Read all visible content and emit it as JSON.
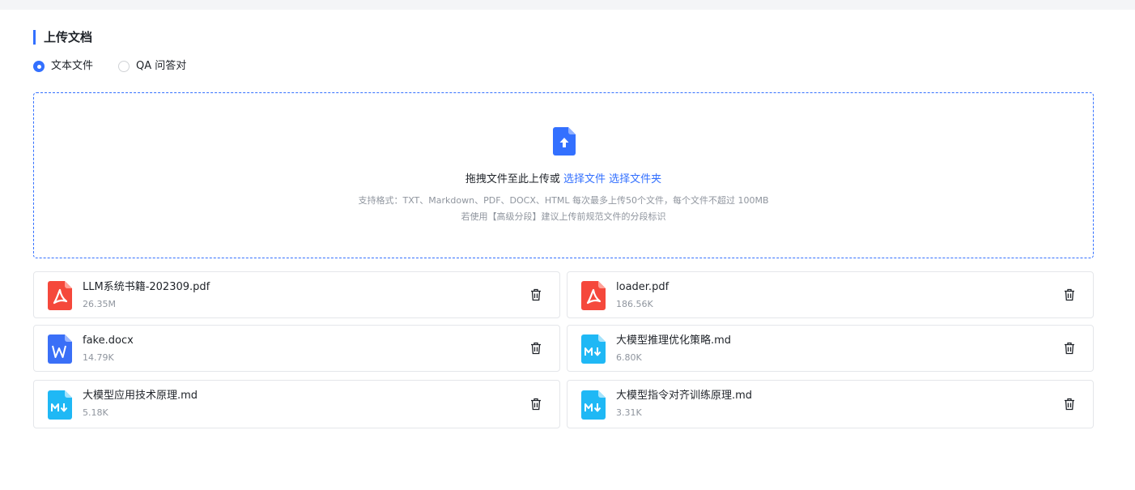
{
  "section_title": "上传文档",
  "radios": [
    {
      "label": "文本文件",
      "checked": true
    },
    {
      "label": "QA 问答对",
      "checked": false
    }
  ],
  "dropzone": {
    "main_text": "拖拽文件至此上传或",
    "select_file": "选择文件",
    "select_folder": "选择文件夹",
    "hint_line1": "支持格式：TXT、Markdown、PDF、DOCX、HTML 每次最多上传50个文件，每个文件不超过 100MB",
    "hint_line2": "若使用【高级分段】建议上传前规范文件的分段标识"
  },
  "files": [
    {
      "name": "LLM系统书籍-202309.pdf",
      "size": "26.35M",
      "type": "pdf-icon"
    },
    {
      "name": "loader.pdf",
      "size": "186.56K",
      "type": "pdf-icon"
    },
    {
      "name": "fake.docx",
      "size": "14.79K",
      "type": "word-icon"
    },
    {
      "name": "大模型推理优化策略.md",
      "size": "6.80K",
      "type": "markdown-icon"
    },
    {
      "name": "大模型应用技术原理.md",
      "size": "5.18K",
      "type": "markdown-icon"
    },
    {
      "name": "大模型指令对齐训练原理.md",
      "size": "3.31K",
      "type": "markdown-icon"
    }
  ],
  "colors": {
    "accent": "#3370ff",
    "pdf": "#f5483b",
    "word": "#3a6ff7",
    "markdown": "#1fb8f5"
  }
}
